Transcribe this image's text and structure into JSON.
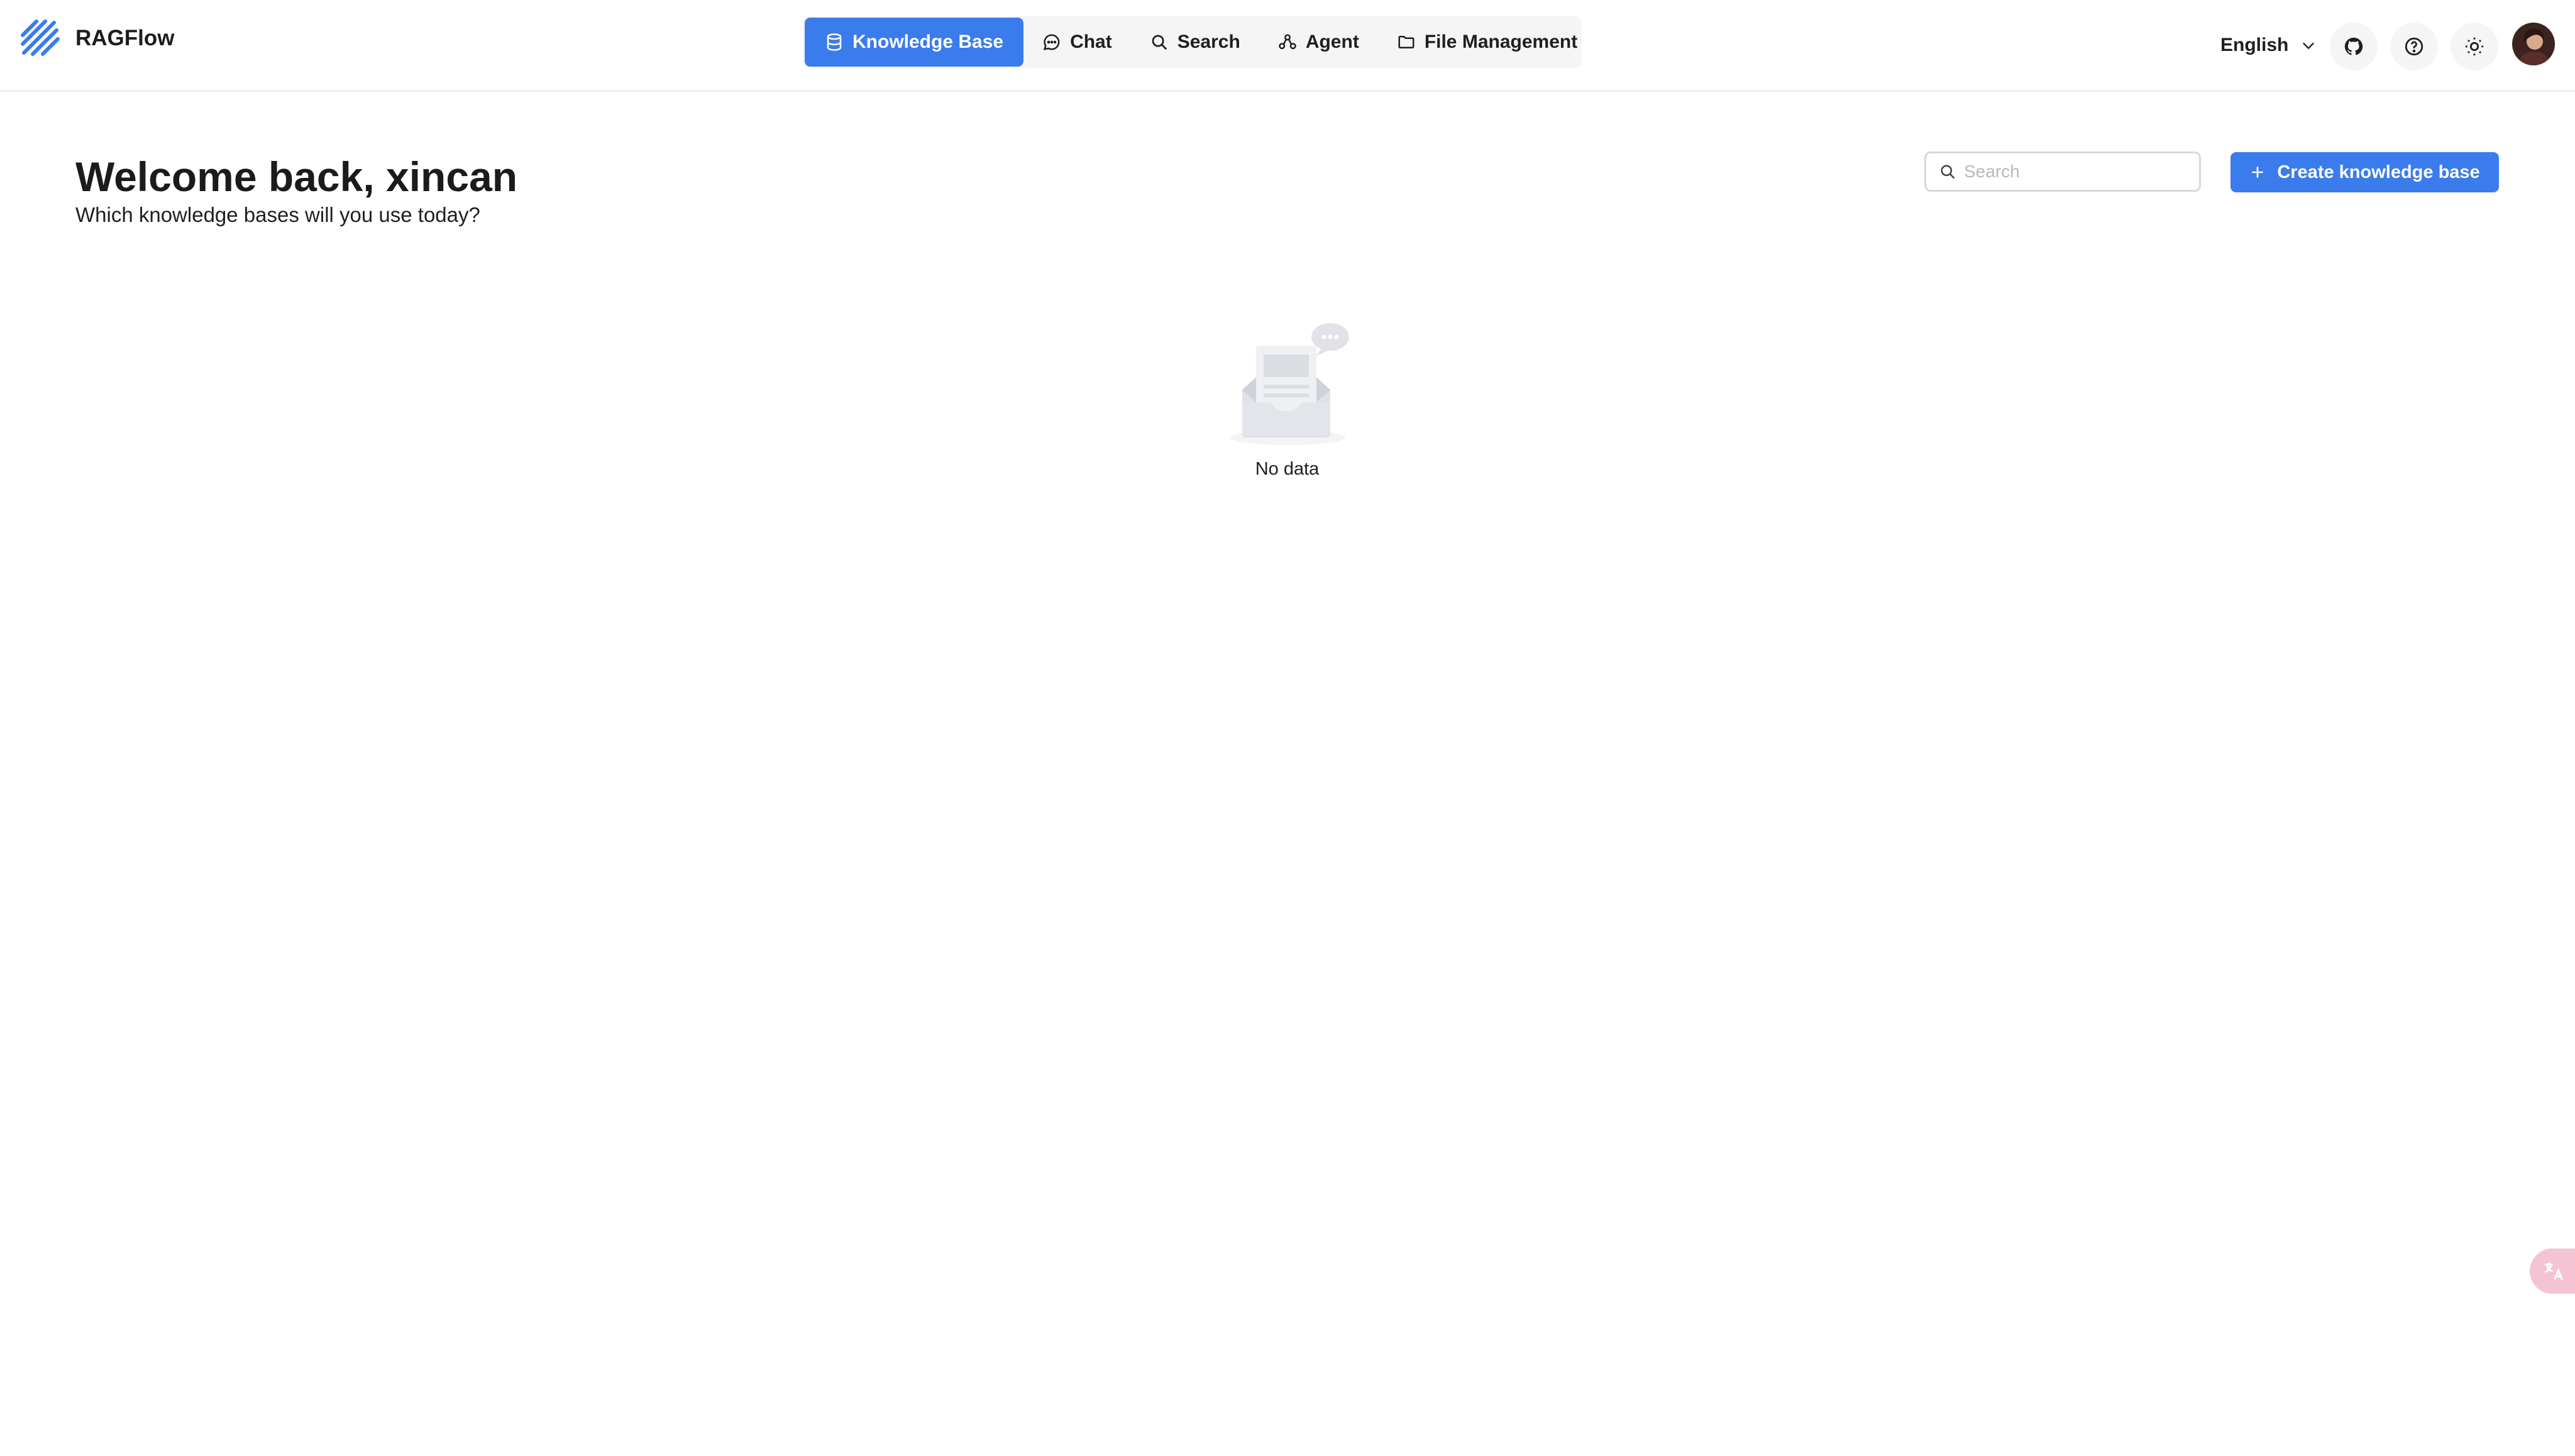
{
  "app": {
    "name": "RAGFlow"
  },
  "nav": {
    "items": [
      {
        "label": "Knowledge Base",
        "icon": "database-icon",
        "active": true
      },
      {
        "label": "Chat",
        "icon": "chat-bubble-icon",
        "active": false
      },
      {
        "label": "Search",
        "icon": "search-icon",
        "active": false
      },
      {
        "label": "Agent",
        "icon": "agent-graph-icon",
        "active": false
      },
      {
        "label": "File Management",
        "icon": "folder-icon",
        "active": false
      }
    ]
  },
  "header_right": {
    "language": "English",
    "icons": [
      "github-icon",
      "help-icon",
      "sun-theme-icon"
    ]
  },
  "main": {
    "title": "Welcome back, xincan",
    "subtitle": "Which knowledge bases will you use today?",
    "search": {
      "placeholder": "Search",
      "value": ""
    },
    "create_button_label": "Create knowledge base",
    "empty_text": "No data"
  },
  "colors": {
    "accent": "#3a7cec",
    "nav_background": "#f5f5f5",
    "border": "#d9d9d9",
    "float_tab": "#f4c4d4"
  }
}
